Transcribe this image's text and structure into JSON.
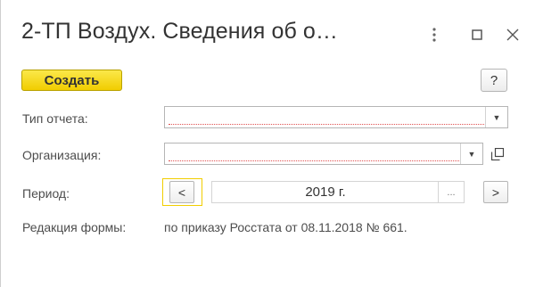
{
  "window": {
    "title": "2-ТП Воздух. Сведения об о…",
    "more_icon": "more-vertical-icon",
    "maximize_icon": "maximize-icon",
    "close_icon": "close-icon"
  },
  "toolbar": {
    "create_label": "Создать",
    "help_label": "?"
  },
  "form": {
    "report_type": {
      "label": "Тип отчета:",
      "value": ""
    },
    "organization": {
      "label": "Организация:",
      "value": ""
    },
    "period": {
      "label": "Период:",
      "value": "2019 г.",
      "dots": "..."
    },
    "edition": {
      "label": "Редакция формы:",
      "value": "по приказу Росстата от 08.11.2018 № 661."
    }
  },
  "colors": {
    "accent": "#f1cd00",
    "required_underline": "#e05050",
    "border": "#b5b5b5"
  }
}
